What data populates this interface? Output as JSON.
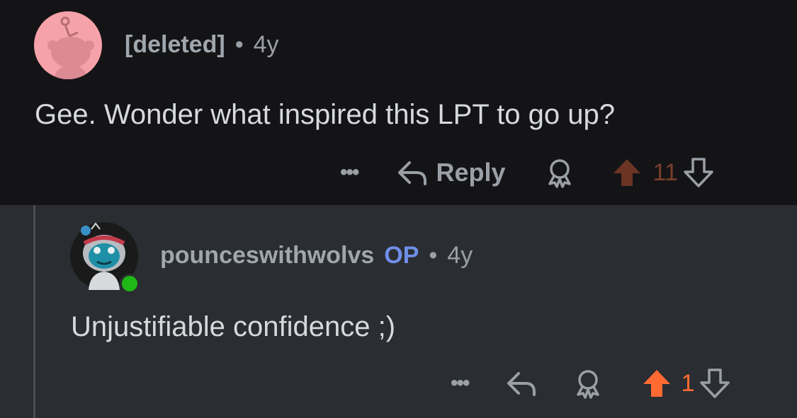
{
  "comments": [
    {
      "author": "[deleted]",
      "age": "4y",
      "separator": "•",
      "body": "Gee. Wonder what inspired this LPT to go up?",
      "actions": {
        "more": "•••",
        "reply": "Reply",
        "score": "11"
      },
      "colors": {
        "upvote": "#6b3423",
        "score": "#7a3e2c"
      }
    },
    {
      "author": "pounceswithwolvs",
      "badge": "OP",
      "age": "4y",
      "separator": "•",
      "body": "Unjustifiable confidence ;)",
      "actions": {
        "more": "•••",
        "score": "1"
      },
      "colors": {
        "upvote": "#ff6a33",
        "score": "#ff6a33"
      }
    }
  ]
}
